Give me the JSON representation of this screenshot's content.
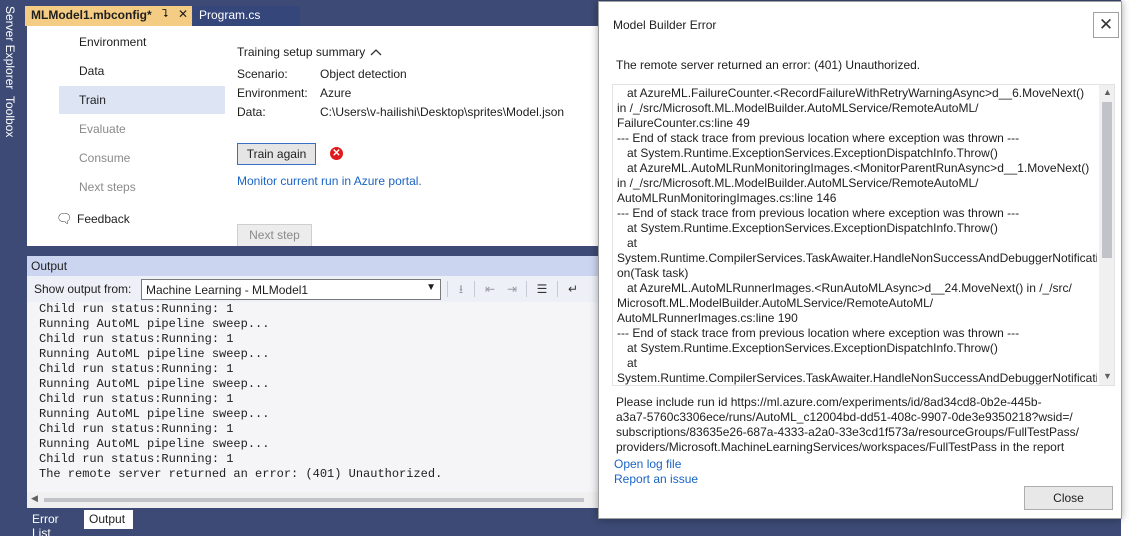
{
  "side_strip": {
    "server_explorer": "Server Explorer",
    "toolbox": "Toolbox"
  },
  "tabs": {
    "model_builder": "MLModel1.mbconfig*",
    "program": "Program.cs"
  },
  "nav": {
    "environment": "Environment",
    "data": "Data",
    "train": "Train",
    "evaluate": "Evaluate",
    "consume": "Consume",
    "next_steps": "Next steps",
    "feedback": "Feedback"
  },
  "summary": {
    "title": "Training setup summary",
    "scenario_label": "Scenario:",
    "scenario_value": "Object detection",
    "environment_label": "Environment:",
    "environment_value": "Azure",
    "data_label": "Data:",
    "data_value": "C:\\Users\\v-hailishi\\Desktop\\sprites\\Model.json"
  },
  "actions": {
    "train_again": "Train again",
    "monitor_link": "Monitor current run in Azure portal.",
    "next_step": "Next step"
  },
  "output": {
    "title": "Output",
    "show_from_label": "Show output from:",
    "source": "Machine Learning - MLModel1",
    "lines": [
      "Child run status:Running: 1",
      "Running AutoML pipeline sweep...",
      "Child run status:Running: 1",
      "Running AutoML pipeline sweep...",
      "Child run status:Running: 1",
      "Running AutoML pipeline sweep...",
      "Child run status:Running: 1",
      "Running AutoML pipeline sweep...",
      "Child run status:Running: 1",
      "Running AutoML pipeline sweep...",
      "Child run status:Running: 1",
      "The remote server returned an error: (401) Unauthorized."
    ]
  },
  "bottom_tabs": {
    "error_list": "Error List",
    "output": "Output"
  },
  "dialog": {
    "title": "Model Builder Error",
    "message": "The remote server returned an error: (401) Unauthorized.",
    "trace": [
      "   at AzureML.FailureCounter.<RecordFailureWithRetryWarningAsync>d__6.MoveNext()",
      "in /_/src/Microsoft.ML.ModelBuilder.AutoMLService/RemoteAutoML/",
      "FailureCounter.cs:line 49",
      "--- End of stack trace from previous location where exception was thrown ---",
      "   at System.Runtime.ExceptionServices.ExceptionDispatchInfo.Throw()",
      "   at AzureML.AutoMLRunMonitoringImages.<MonitorParentRunAsync>d__1.MoveNext()",
      "in /_/src/Microsoft.ML.ModelBuilder.AutoMLService/RemoteAutoML/",
      "AutoMLRunMonitoringImages.cs:line 146",
      "--- End of stack trace from previous location where exception was thrown ---",
      "   at System.Runtime.ExceptionServices.ExceptionDispatchInfo.Throw()",
      "   at",
      "System.Runtime.CompilerServices.TaskAwaiter.HandleNonSuccessAndDebuggerNotificati",
      "on(Task task)",
      "   at AzureML.AutoMLRunnerImages.<RunAutoMLAsync>d__24.MoveNext() in /_/src/",
      "Microsoft.ML.ModelBuilder.AutoMLService/RemoteAutoML/",
      "AutoMLRunnerImages.cs:line 190",
      "--- End of stack trace from previous location where exception was thrown ---",
      "   at System.Runtime.ExceptionServices.ExceptionDispatchInfo.Throw()",
      "   at",
      "System.Runtime.CompilerServices.TaskAwaiter.HandleNonSuccessAndDebuggerNotificati"
    ],
    "include": [
      "Please include run id https://ml.azure.com/experiments/id/8ad34cd8-0b2e-445b-",
      "a3a7-5760c3306ece/runs/AutoML_c12004bd-dd51-408c-9907-0de3e9350218?wsid=/",
      "subscriptions/83635e26-687a-4333-a2a0-33e3cd1f573a/resourceGroups/FullTestPass/",
      "providers/Microsoft.MachineLearningServices/workspaces/FullTestPass in the report"
    ],
    "open_log": "Open log file",
    "report_issue": "Report an issue",
    "close_button": "Close"
  },
  "colors": {
    "chrome": "#3c4a75",
    "active_tab": "#f5cc84",
    "selected_nav": "#dde5f5",
    "link": "#1a64c4",
    "error": "#e01a1a"
  },
  "icons": [
    "pin-icon",
    "close-icon",
    "chevron-up-icon",
    "error-circle-icon",
    "feedback-icon",
    "dropdown-arrow-icon"
  ]
}
